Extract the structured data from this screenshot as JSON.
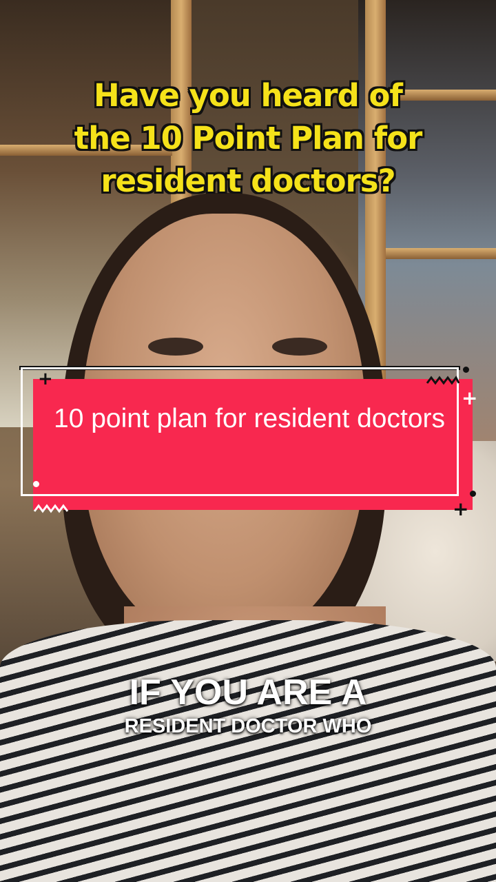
{
  "overlay": {
    "top_caption": {
      "lines": [
        "Have you heard of",
        "the 10 Point Plan for",
        "resident doctors?"
      ],
      "color": "#f5e21a"
    },
    "sticker": {
      "text": "10 point plan for resident doctors",
      "color": "#f8284f",
      "decorations": [
        "plus-icon",
        "plus-icon",
        "plus-icon",
        "zigzag-icon",
        "zigzag-icon",
        "dot-icon",
        "dot-icon"
      ]
    },
    "bottom_caption": {
      "line1": "IF YOU ARE A",
      "line2": "RESIDENT DOCTOR WHO"
    }
  }
}
